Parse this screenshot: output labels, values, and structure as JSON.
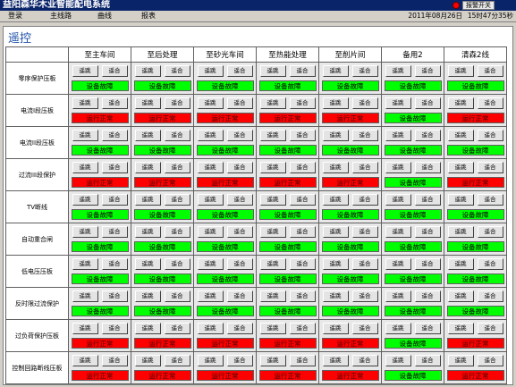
{
  "window": {
    "title": "益阳森华木业智能配电系统",
    "alarm_button": "报警开关",
    "colors": {
      "title_bg": "#0a246a",
      "alarm": "#ff0000"
    }
  },
  "menu": {
    "items": [
      "登录",
      "主线路",
      "曲线",
      "报表"
    ],
    "date": "2011年08月26日",
    "time": "15时47分35秒"
  },
  "page": {
    "title": "遥控"
  },
  "table": {
    "columns": [
      "至主车间",
      "至后处理",
      "至砂光车间",
      "至热能处理",
      "至削片间",
      "备用2",
      "清森2线"
    ],
    "buttons": {
      "trip": "遥跳",
      "close": "遥合"
    },
    "status_labels": {
      "fault": "设备故障",
      "normal": "运行正常"
    },
    "colors": {
      "fault": "#00ff00",
      "normal": "#ff0000"
    },
    "rows": [
      {
        "label": "零序保护压板",
        "status": [
          "fault",
          "fault",
          "fault",
          "fault",
          "fault",
          "fault",
          "fault"
        ]
      },
      {
        "label": "电流I段压板",
        "status": [
          "normal",
          "normal",
          "normal",
          "normal",
          "normal",
          "fault",
          "normal"
        ]
      },
      {
        "label": "电流II段压板",
        "status": [
          "fault",
          "fault",
          "fault",
          "fault",
          "fault",
          "fault",
          "fault"
        ]
      },
      {
        "label": "过流III段保护",
        "status": [
          "normal",
          "normal",
          "normal",
          "normal",
          "normal",
          "fault",
          "normal"
        ]
      },
      {
        "label": "TV断线",
        "status": [
          "fault",
          "fault",
          "fault",
          "fault",
          "fault",
          "fault",
          "fault"
        ]
      },
      {
        "label": "自动重合闸",
        "status": [
          "fault",
          "fault",
          "fault",
          "fault",
          "fault",
          "fault",
          "fault"
        ]
      },
      {
        "label": "低电压压板",
        "status": [
          "fault",
          "fault",
          "fault",
          "fault",
          "fault",
          "fault",
          "fault"
        ]
      },
      {
        "label": "反时限过流保护",
        "status": [
          "fault",
          "fault",
          "fault",
          "fault",
          "fault",
          "fault",
          "fault"
        ]
      },
      {
        "label": "过负荷保护压板",
        "status": [
          "normal",
          "normal",
          "normal",
          "normal",
          "normal",
          "fault",
          "normal"
        ]
      },
      {
        "label": "控制回路断线压板",
        "status": [
          "normal",
          "normal",
          "normal",
          "normal",
          "normal",
          "fault",
          "normal"
        ]
      }
    ]
  }
}
